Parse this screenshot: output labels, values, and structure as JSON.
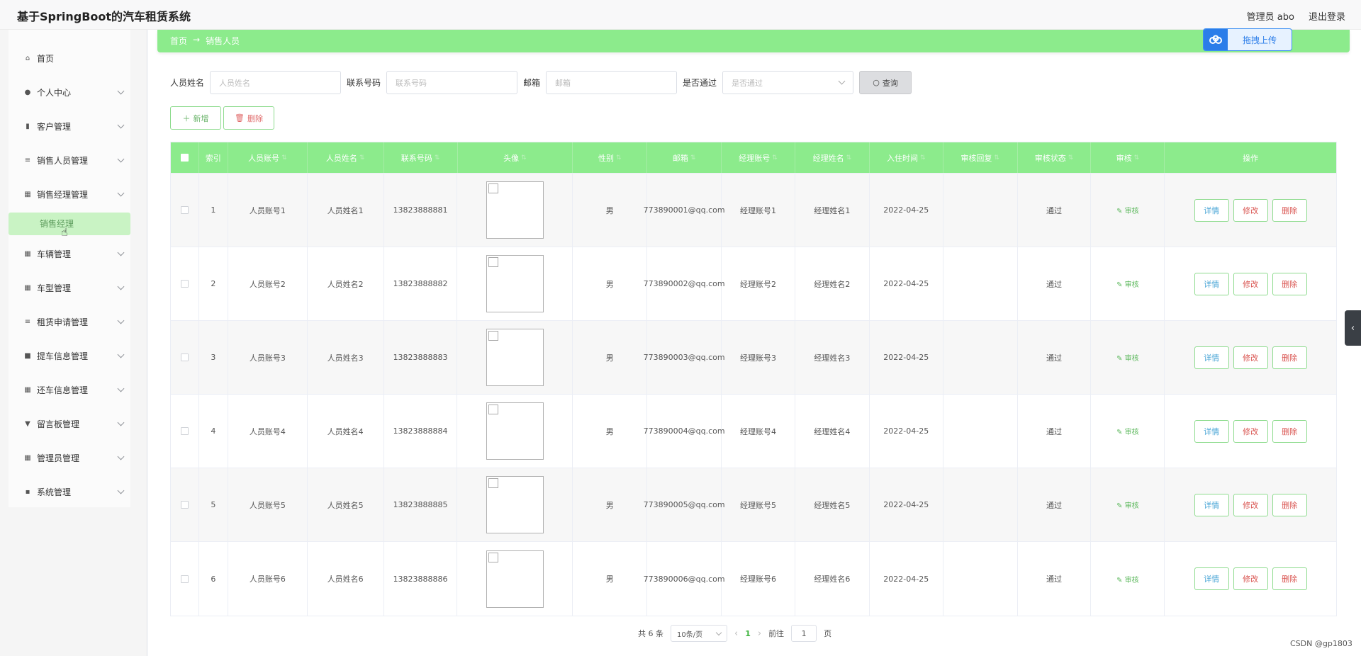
{
  "app": {
    "title": "基于SpringBoot的汽车租赁系统"
  },
  "header": {
    "user_label": "管理员 abo",
    "logout_label": "退出登录"
  },
  "sidebar": {
    "items": [
      {
        "label": "首页",
        "icon": "home-icon"
      },
      {
        "label": "个人中心",
        "icon": "user-icon"
      },
      {
        "label": "客户管理",
        "icon": "bar-chart-icon"
      },
      {
        "label": "销售人员管理",
        "icon": "list-icon"
      },
      {
        "label": "销售经理管理",
        "icon": "grid-icon"
      },
      {
        "label": "车辆管理",
        "icon": "grid-icon"
      },
      {
        "label": "车型管理",
        "icon": "grid-icon"
      },
      {
        "label": "租赁申请管理",
        "icon": "sliders-icon"
      },
      {
        "label": "提车信息管理",
        "icon": "chat-icon"
      },
      {
        "label": "还车信息管理",
        "icon": "grid-icon"
      },
      {
        "label": "留言板管理",
        "icon": "filter-icon"
      },
      {
        "label": "管理员管理",
        "icon": "grid-icon"
      },
      {
        "label": "系统管理",
        "icon": "trash-icon"
      }
    ],
    "active_sub": "销售经理"
  },
  "breadcrumb": {
    "home": "首页",
    "separator": "→",
    "current": "销售人员"
  },
  "upload": {
    "label": "拖拽上传"
  },
  "search": {
    "name_label": "人员姓名",
    "name_placeholder": "人员姓名",
    "phone_label": "联系号码",
    "phone_placeholder": "联系号码",
    "email_label": "邮箱",
    "email_placeholder": "邮箱",
    "pass_label": "是否通过",
    "pass_placeholder": "是否通过",
    "query_label": "查询"
  },
  "actions": {
    "add_label": "新增",
    "delete_label": "删除"
  },
  "table": {
    "headers": [
      "索引",
      "人员账号",
      "人员姓名",
      "联系号码",
      "头像",
      "性别",
      "邮箱",
      "经理账号",
      "经理姓名",
      "入住时间",
      "审核回复",
      "审核状态",
      "审核",
      "操作"
    ],
    "rows": [
      {
        "index": "1",
        "account": "人员账号1",
        "name": "人员姓名1",
        "phone": "13823888881",
        "gender": "男",
        "email": "773890001@qq.com",
        "mgr_account": "经理账号1",
        "mgr_name": "经理姓名1",
        "date": "2022-04-25",
        "reply": "",
        "status": "通过",
        "audit": "审核"
      },
      {
        "index": "2",
        "account": "人员账号2",
        "name": "人员姓名2",
        "phone": "13823888882",
        "gender": "男",
        "email": "773890002@qq.com",
        "mgr_account": "经理账号2",
        "mgr_name": "经理姓名2",
        "date": "2022-04-25",
        "reply": "",
        "status": "通过",
        "audit": "审核"
      },
      {
        "index": "3",
        "account": "人员账号3",
        "name": "人员姓名3",
        "phone": "13823888883",
        "gender": "男",
        "email": "773890003@qq.com",
        "mgr_account": "经理账号3",
        "mgr_name": "经理姓名3",
        "date": "2022-04-25",
        "reply": "",
        "status": "通过",
        "audit": "审核"
      },
      {
        "index": "4",
        "account": "人员账号4",
        "name": "人员姓名4",
        "phone": "13823888884",
        "gender": "男",
        "email": "773890004@qq.com",
        "mgr_account": "经理账号4",
        "mgr_name": "经理姓名4",
        "date": "2022-04-25",
        "reply": "",
        "status": "通过",
        "audit": "审核"
      },
      {
        "index": "5",
        "account": "人员账号5",
        "name": "人员姓名5",
        "phone": "13823888885",
        "gender": "男",
        "email": "773890005@qq.com",
        "mgr_account": "经理账号5",
        "mgr_name": "经理姓名5",
        "date": "2022-04-25",
        "reply": "",
        "status": "通过",
        "audit": "审核"
      },
      {
        "index": "6",
        "account": "人员账号6",
        "name": "人员姓名6",
        "phone": "13823888886",
        "gender": "男",
        "email": "773890006@qq.com",
        "mgr_account": "经理账号6",
        "mgr_name": "经理姓名6",
        "date": "2022-04-25",
        "reply": "",
        "status": "通过",
        "audit": "审核"
      }
    ],
    "row_actions": {
      "detail": "详情",
      "edit": "修改",
      "delete": "删除"
    }
  },
  "pagination": {
    "total": "共 6 条",
    "page_size": "10条/页",
    "current_page": "1",
    "goto_prefix": "前往",
    "goto_value": "1",
    "goto_suffix": "页"
  },
  "watermark": "CSDN @gp1803"
}
